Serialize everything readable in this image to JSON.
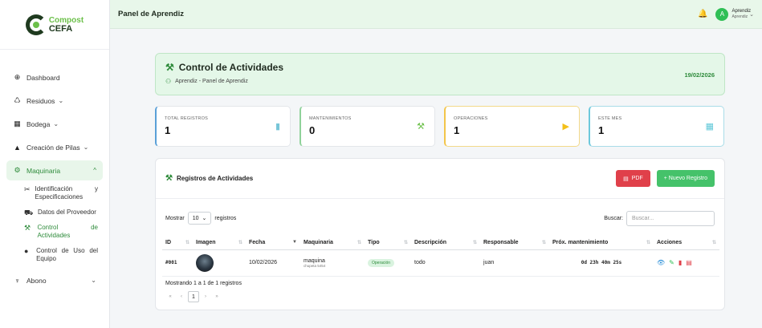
{
  "brand": {
    "line1": "Compost",
    "line2": "CEFA"
  },
  "sidebar": {
    "items": [
      {
        "label": "Dashboard",
        "icon": "⊕",
        "chevron": ""
      },
      {
        "label": "Residuos",
        "icon": "♺",
        "chevron": "⌄"
      },
      {
        "label": "Bodega",
        "icon": "▦",
        "chevron": "⌄"
      },
      {
        "label": "Creación de Pilas",
        "icon": "▲",
        "chevron": "⌄"
      },
      {
        "label": "Maquinaria",
        "icon": "⚙",
        "chevron": "^"
      },
      {
        "label": "Abono",
        "icon": "♆",
        "chevron": "⌄"
      }
    ],
    "sub": [
      {
        "label": "Identificación y Especificaciones",
        "icon": "✂"
      },
      {
        "label": "Datos del Proveedor",
        "icon": "⛟"
      },
      {
        "label": "Control de Actividades",
        "icon": "⚒"
      },
      {
        "label": "Control de Uso del Equipo",
        "icon": "●"
      }
    ]
  },
  "topbar": {
    "title": "Panel de Aprendiz",
    "user_name": "Aprendiz",
    "user_role": "Aprendiz",
    "user_initial": "A",
    "bell": "🔔",
    "chevron": "⌄"
  },
  "banner": {
    "title": "Control de Actividades",
    "subtitle": "Aprendiz - Panel de Aprendiz",
    "date": "19/02/2026"
  },
  "stats": [
    {
      "label": "TOTAL REGISTROS",
      "value": "1",
      "icon": "▮"
    },
    {
      "label": "MANTENIMIENTOS",
      "value": "0",
      "icon": "⚒"
    },
    {
      "label": "OPERACIONES",
      "value": "1",
      "icon": "▶"
    },
    {
      "label": "ESTE MES",
      "value": "1",
      "icon": "▦"
    }
  ],
  "registros": {
    "title": "Registros de Actividades",
    "pdf_label": "PDF",
    "new_label": "+ Nuevo Registro",
    "show_label": "Mostrar",
    "page_size": "10",
    "records_label": "registros",
    "search_label": "Buscar:",
    "search_placeholder": "Buscar...",
    "columns": [
      "ID",
      "Imagen",
      "Fecha",
      "Maquinaria",
      "Tipo",
      "Descripción",
      "Responsable",
      "Próx. mantenimiento",
      "Acciones"
    ],
    "rows": [
      {
        "id": "#001",
        "fecha": "10/02/2026",
        "maquina": "maquina",
        "maquina_sub": "chupeta 5454",
        "tipo": "Operación",
        "descripcion": "todo",
        "responsable": "juan",
        "prox": "0d 23h 40m 25s"
      }
    ],
    "info": "Mostrando 1 a 1 de 1 registros",
    "pager": {
      "first": "«",
      "prev": "‹",
      "current": "1",
      "next": "›",
      "last": "»"
    }
  },
  "colors": {
    "primary": "#2e8b3b",
    "accent_green": "#45c26a",
    "danger": "#e0404a",
    "banner_bg": "#e4f7e8"
  }
}
